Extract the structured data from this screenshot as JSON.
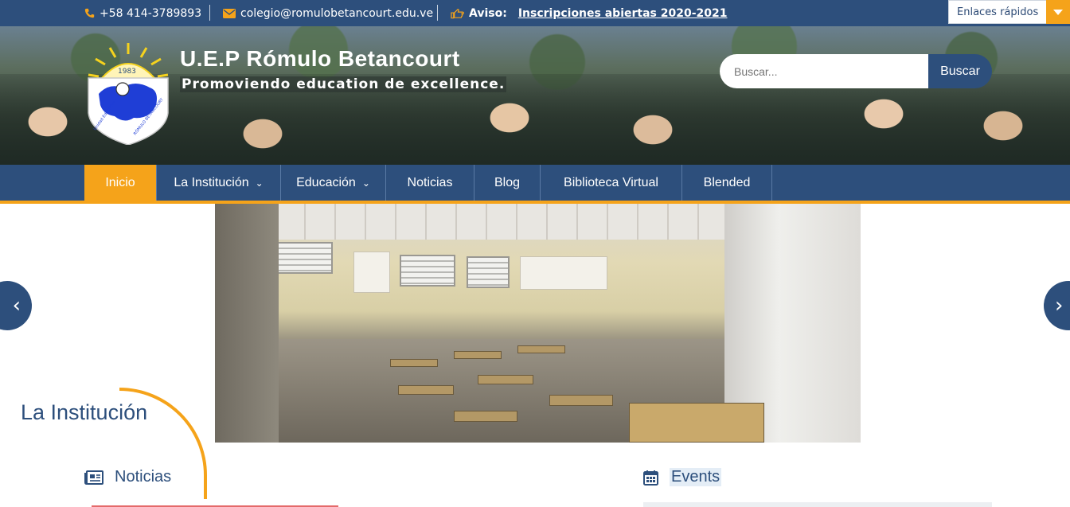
{
  "topbar": {
    "phone": "+58 414-3789893",
    "email": "colegio@romulobetancourt.edu.ve",
    "notice_label": "Aviso:",
    "notice_link": "Inscripciones abiertas 2020-2021",
    "quick_links": "Enlaces rápidos",
    "icons": {
      "phone": "phone-icon",
      "email": "envelope-icon",
      "notice": "hand-pointing-icon",
      "dropdown": "caret-down-icon"
    }
  },
  "header": {
    "site_title": "U.E.P Rómulo Betancourt",
    "tagline": "Promoviendo education de excellence.",
    "logo": {
      "year": "1983",
      "left_text": "Unidad Educativa",
      "right_text": "RÓMULO BETANCOURT"
    },
    "search": {
      "placeholder": "Buscar...",
      "button": "Buscar"
    }
  },
  "nav": {
    "items": [
      {
        "label": "Inicio",
        "active": true,
        "has_submenu": false
      },
      {
        "label": "La Institución",
        "active": false,
        "has_submenu": true
      },
      {
        "label": "Educación",
        "active": false,
        "has_submenu": true
      },
      {
        "label": "Noticias",
        "active": false,
        "has_submenu": false
      },
      {
        "label": "Blog",
        "active": false,
        "has_submenu": false
      },
      {
        "label": "Biblioteca Virtual",
        "active": false,
        "has_submenu": false
      },
      {
        "label": "Blended",
        "active": false,
        "has_submenu": false
      }
    ],
    "chevron": "⌄"
  },
  "slider": {
    "caption": "La Institución",
    "prev_icon": "chevron-left-icon",
    "next_icon": "chevron-right-icon",
    "prev_glyph": "‹",
    "next_glyph": "›"
  },
  "sections": {
    "news": {
      "title": "Noticias",
      "icon": "newspaper-icon"
    },
    "events": {
      "title": "Events",
      "icon": "calendar-icon"
    }
  },
  "colors": {
    "primary": "#2d4f7c",
    "accent": "#f5a31a"
  }
}
